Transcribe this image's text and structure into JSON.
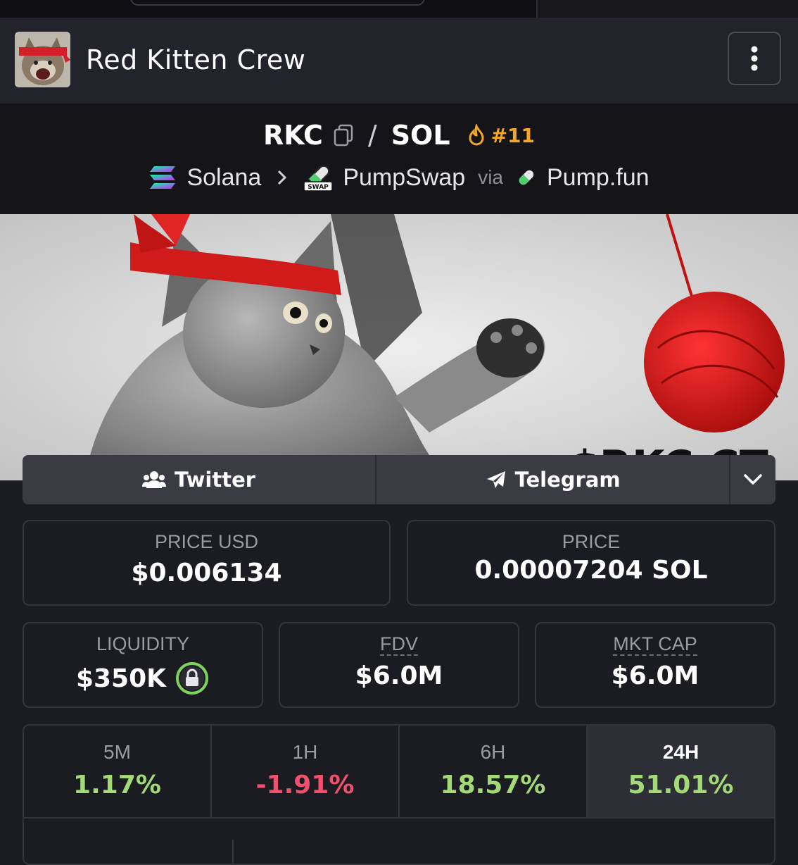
{
  "header": {
    "title": "Red Kitten Crew"
  },
  "pair": {
    "base": "RKC",
    "quote": "SOL",
    "rank": "#11"
  },
  "chain": {
    "network": "Solana",
    "dex": "PumpSwap",
    "via_label": "via",
    "launchpad": "Pump.fun",
    "dex_badge": "SWAP"
  },
  "banner": {
    "overlay_text": "$RKC CT"
  },
  "socials": {
    "twitter": "Twitter",
    "telegram": "Telegram"
  },
  "stats": {
    "price_usd": {
      "label": "PRICE USD",
      "value": "$0.006134"
    },
    "price": {
      "label": "PRICE",
      "value": "0.00007204 SOL"
    },
    "liquidity": {
      "label": "LIQUIDITY",
      "value": "$350K"
    },
    "fdv": {
      "label": "FDV",
      "value": "$6.0M"
    },
    "mkt_cap": {
      "label": "MKT CAP",
      "value": "$6.0M"
    }
  },
  "changes": [
    {
      "period": "5M",
      "value": "1.17%",
      "color": "#a3d977"
    },
    {
      "period": "1H",
      "value": "-1.91%",
      "color": "#f0506e"
    },
    {
      "period": "6H",
      "value": "18.57%",
      "color": "#a3d977"
    },
    {
      "period": "24H",
      "value": "51.01%",
      "color": "#a3d977"
    }
  ],
  "colors": {
    "accent_orange": "#f5a623",
    "positive": "#a3d977",
    "negative": "#f0506e",
    "lock_ring": "#7fd35a"
  }
}
